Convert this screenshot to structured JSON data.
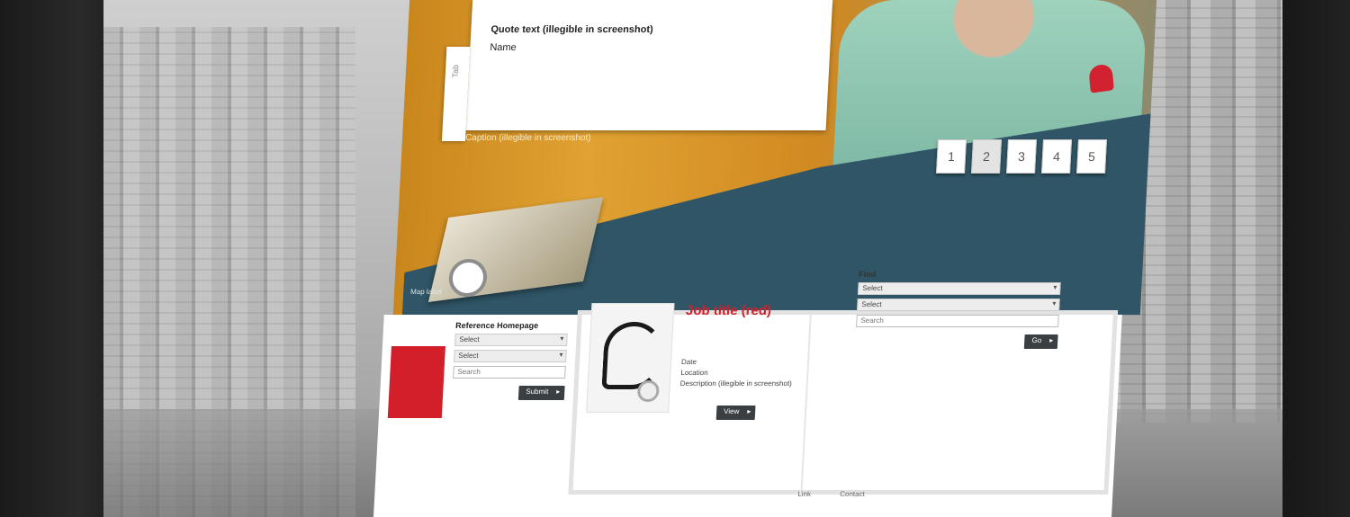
{
  "hero": {
    "quote": "Quote text (illegible in screenshot)",
    "quote_name": "Name",
    "side_tab": "Tab",
    "caption": "Caption (illegible in screenshot)",
    "slides": [
      "1",
      "2",
      "3",
      "4",
      "5"
    ],
    "active_slide": 2,
    "map_label": "Map label"
  },
  "reference": {
    "title": "Reference Homepage",
    "select1": "Select",
    "select2": "Select",
    "input_placeholder": "Search",
    "button": "Submit"
  },
  "job": {
    "title": "Job title (red)",
    "date": "Date",
    "location": "Location",
    "description": "Description (illegible in screenshot)",
    "button": "View"
  },
  "find": {
    "title": "Find",
    "select1": "Select",
    "select2": "Select",
    "input_placeholder": "Search",
    "button": "Go"
  },
  "footer": {
    "link1": "Link",
    "link2": "Contact"
  },
  "colors": {
    "accent": "#d3202d",
    "teal": "#2f5566",
    "button_dark": "#3a3f44"
  }
}
